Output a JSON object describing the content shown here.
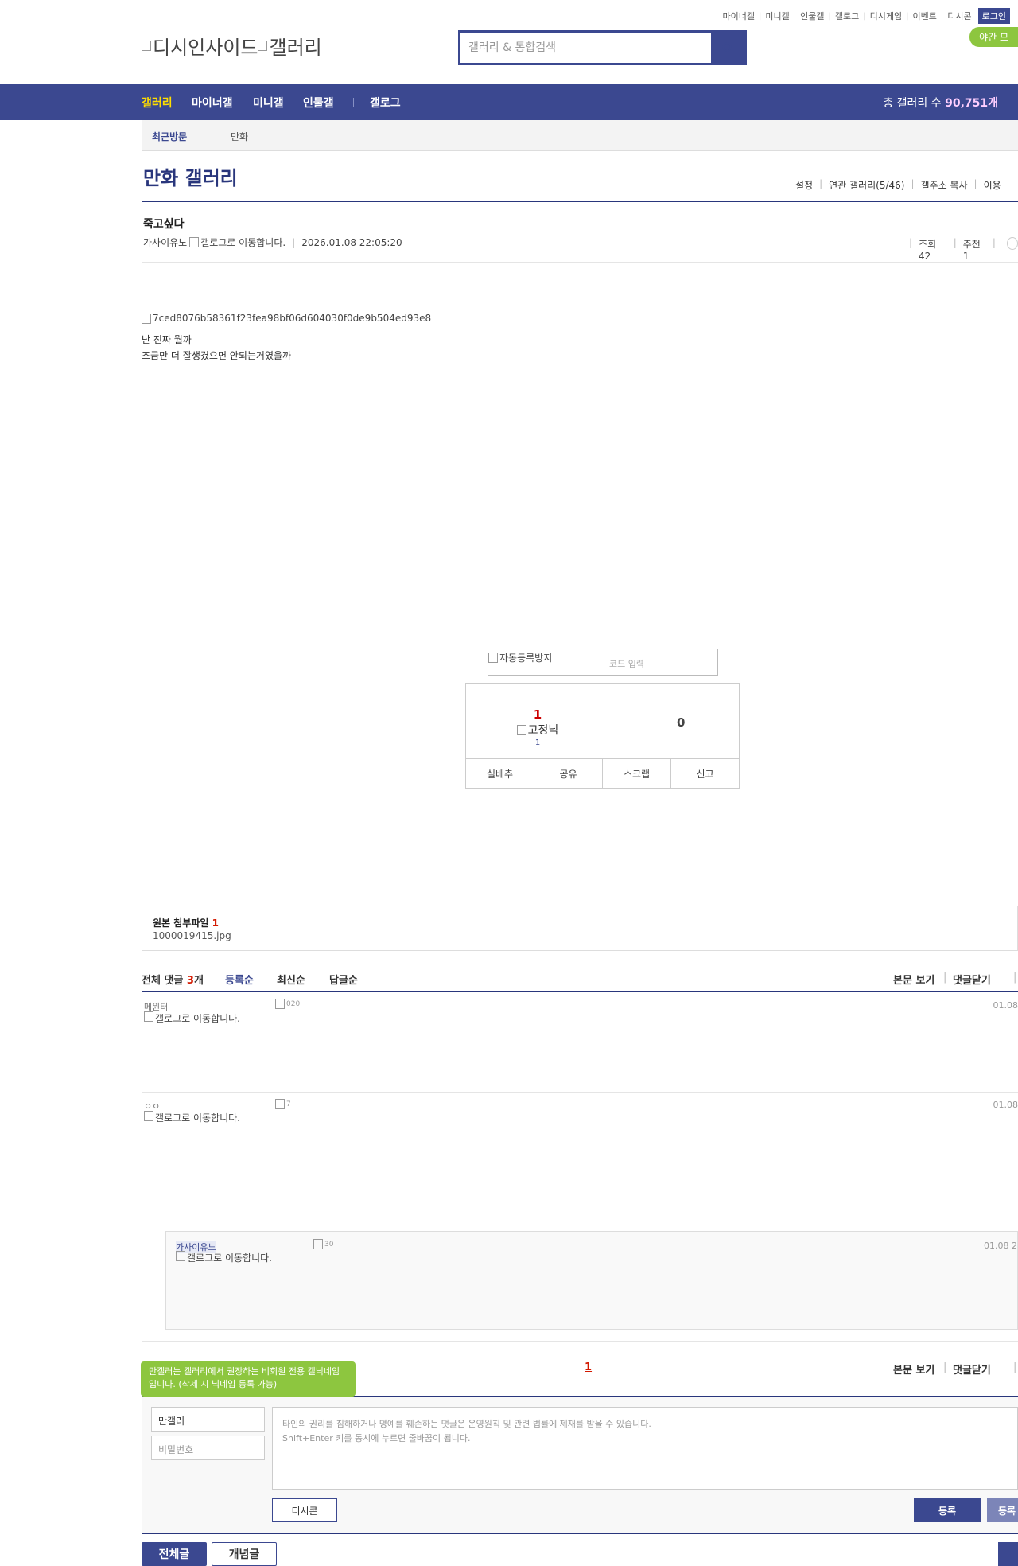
{
  "topnav": [
    "마이너갤",
    "미니갤",
    "인물갤",
    "갤로그",
    "디시게임",
    "이벤트",
    "디시콘"
  ],
  "login_label": "로그인",
  "night_label": "야간 모",
  "logo_alt_1": "디시인사이드",
  "logo_alt_2": "갤러리",
  "search": {
    "placeholder": "갤러리 & 통합검색"
  },
  "gnb": {
    "items": [
      "갤러리",
      "마이너갤",
      "미니갤",
      "인물갤",
      "갤로그"
    ],
    "total_label": "총 갤러리 수 ",
    "total_value": "90,751개"
  },
  "recent": {
    "label": "최근방문",
    "item": "만화"
  },
  "gallery": {
    "title": "만화 갤러리",
    "links": [
      "설정",
      "연관 갤러리(5/46)",
      "갤주소 복사",
      "이용"
    ]
  },
  "post": {
    "title": "죽고싶다",
    "author": "가사이유노",
    "gallog_alt": "갤로그로 이동합니다.",
    "date": "2026.01.08 22:05:20",
    "views": "조회 42",
    "recommend": "추천 1",
    "image_alt": "7ced8076b58361f23fea98bf06d604030f0de9b504ed93e8",
    "lines": [
      "난 진짜 뭘까",
      "조금만 더 잘생겼으면 안되는거였을까"
    ]
  },
  "captcha": {
    "alt": "자동등록방지",
    "placeholder": "코드 입력"
  },
  "vote": {
    "up": "1",
    "fixed_alt": "고정닉",
    "fixed_count": "1",
    "down": "0",
    "buttons": [
      "실베추",
      "공유",
      "스크랩",
      "신고"
    ]
  },
  "attach": {
    "label": "원본 첨부파일 ",
    "count": "1",
    "file": "1000019415.jpg"
  },
  "comments_header": {
    "total_label": "전체 댓글 ",
    "total_count": "3",
    "total_unit": "개",
    "sort": [
      "등록순",
      "최신순",
      "답글순"
    ],
    "right": [
      "본문 보기",
      "댓글닫기"
    ]
  },
  "comments": [
    {
      "nick": "메윈터",
      "gallog_alt": "갤로그로 이동합니다.",
      "img_alt": "020",
      "date": "01.08"
    },
    {
      "nick": "ㅇㅇ",
      "gallog_alt": "갤로그로 이동합니다.",
      "img_alt": "7",
      "date": "01.08"
    }
  ],
  "reply": {
    "nick": "가사이유노",
    "gallog_alt": "갤로그로 이동합니다.",
    "img_alt": "30",
    "date": "01.08 2"
  },
  "pagination": {
    "current": "1",
    "right": [
      "본문 보기",
      "댓글닫기"
    ]
  },
  "form": {
    "tip": "만갤러는 갤러리에서 권장하는 비회원 전용 갤닉네임입니다. (삭제 시 닉네임 등록 가능)",
    "nickname": "만갤러",
    "password_placeholder": "비밀번호",
    "textarea_line1": "타인의 권리를 침해하거나 명예를 훼손하는 댓글은 운영원칙 및 관련 법률에 제재를 받을 수 있습니다.",
    "textarea_line2": "Shift+Enter 키를 동시에 누르면 줄바꿈이 됩니다.",
    "dccon_label": "디시콘",
    "submit_label": "등록",
    "submit2_label": "등록"
  },
  "bottom_tabs": [
    "전체글",
    "개념글"
  ]
}
